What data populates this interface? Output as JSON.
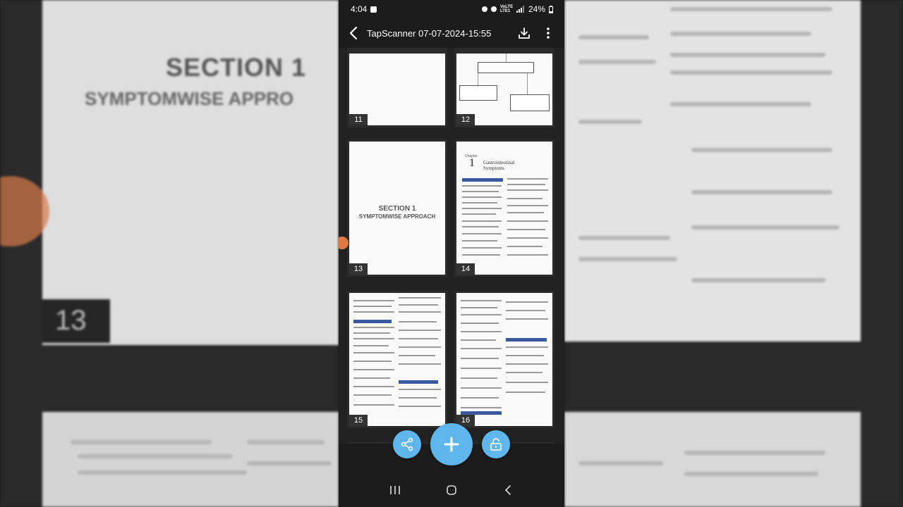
{
  "status_bar": {
    "time": "4:04",
    "battery": "24%",
    "network": "VoLTE LTE1"
  },
  "toolbar": {
    "title": "TapScanner 07-07-2024-15:55",
    "back_icon": "arrow-back-icon",
    "download_icon": "download-icon",
    "more_icon": "more-vert-icon"
  },
  "pages": [
    {
      "number": "11"
    },
    {
      "number": "12"
    },
    {
      "number": "13",
      "heading": "SECTION 1",
      "subheading": "SYMPTOMWISE APPROACH"
    },
    {
      "number": "14",
      "chapter_label": "Chapter",
      "chapter_number": "1",
      "chapter_title": "Gastrointestinal Symptoms"
    },
    {
      "number": "15"
    },
    {
      "number": "16"
    }
  ],
  "fabs": {
    "share_icon": "share-icon",
    "add_icon": "plus-icon",
    "lock_icon": "unlock-icon",
    "color": "#5fb6ec"
  },
  "nav_bar": {
    "recents_icon": "recents-icon",
    "home_icon": "home-icon",
    "back_icon": "back-chevron-icon"
  },
  "background": {
    "heading": "SECTION 1",
    "subheading": "SYMPTOMWISE APPRO",
    "page_number": "13"
  }
}
